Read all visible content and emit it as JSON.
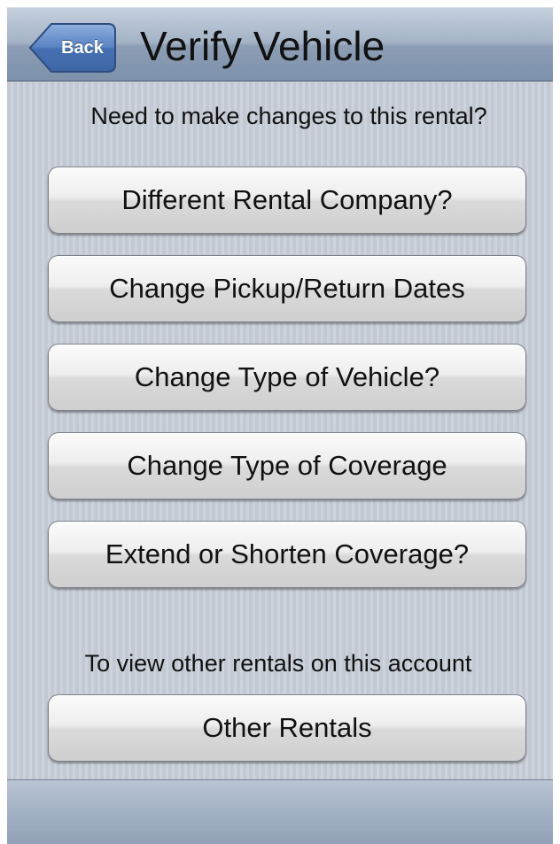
{
  "navbar": {
    "back_label": "Back",
    "title": "Verify Vehicle"
  },
  "main": {
    "prompt": "Need to make changes to this rental?",
    "buttons": [
      {
        "label": "Different Rental Company?"
      },
      {
        "label": "Change Pickup/Return Dates"
      },
      {
        "label": "Change Type of Vehicle?"
      },
      {
        "label": "Change Type of Coverage"
      },
      {
        "label": "Extend or Shorten Coverage?"
      }
    ],
    "other_prompt": "To view other rentals on this account",
    "other_button": "Other Rentals"
  },
  "colors": {
    "navbar": "#8d9eb5",
    "back_button": "#5a83c2",
    "background": "#c6ccd6"
  }
}
